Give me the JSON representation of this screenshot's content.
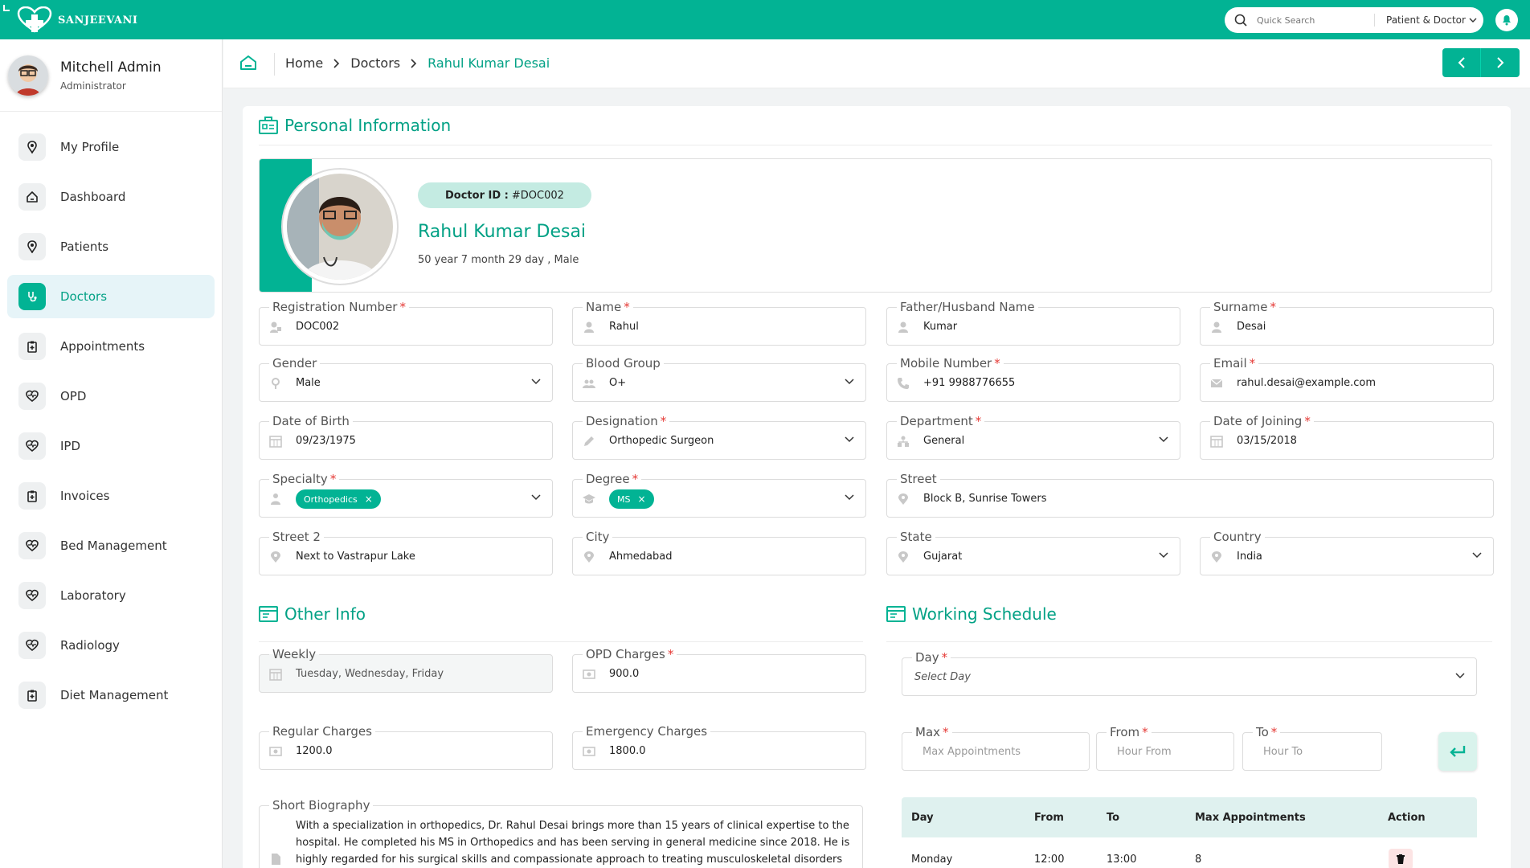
{
  "brand": {
    "name": "SANJEEVANI"
  },
  "colors": {
    "primary": "#02b394",
    "primary_text": "#02a185",
    "active_bg": "#e6f4f8",
    "required": "#e53935"
  },
  "search": {
    "placeholder": "Quick Search",
    "scope": "Patient & Doctor"
  },
  "user": {
    "name": "Mitchell Admin",
    "role": "Administrator"
  },
  "nav": [
    {
      "label": "My Profile",
      "icon": "user-icon"
    },
    {
      "label": "Dashboard",
      "icon": "home-icon"
    },
    {
      "label": "Patients",
      "icon": "user-icon"
    },
    {
      "label": "Doctors",
      "icon": "stethoscope-icon",
      "active": true
    },
    {
      "label": "Appointments",
      "icon": "clipboard-icon"
    },
    {
      "label": "OPD",
      "icon": "heartbeat-icon"
    },
    {
      "label": "IPD",
      "icon": "heartbeat-icon"
    },
    {
      "label": "Invoices",
      "icon": "clipboard-icon"
    },
    {
      "label": "Bed Management",
      "icon": "heartbeat-icon"
    },
    {
      "label": "Laboratory",
      "icon": "heartbeat-icon"
    },
    {
      "label": "Radiology",
      "icon": "heartbeat-icon"
    },
    {
      "label": "Diet Management",
      "icon": "clipboard-icon"
    }
  ],
  "breadcrumb": [
    "Home",
    "Doctors",
    "Rahul Kumar Desai"
  ],
  "personal": {
    "title": "Personal Information",
    "doctor_id_label": "Doctor ID :",
    "doctor_id": "#DOC002",
    "name": "Rahul Kumar Desai",
    "age": "50 year 7 month 29 day , Male"
  },
  "fields": {
    "registration_number": {
      "label": "Registration Number",
      "value": "DOC002"
    },
    "name": {
      "label": "Name",
      "value": "Rahul"
    },
    "father_name": {
      "label": "Father/Husband Name",
      "value": "Kumar"
    },
    "surname": {
      "label": "Surname",
      "value": "Desai"
    },
    "gender": {
      "label": "Gender",
      "value": "Male"
    },
    "blood_group": {
      "label": "Blood Group",
      "value": "O+"
    },
    "mobile": {
      "label": "Mobile Number",
      "value": "+91 9988776655"
    },
    "email": {
      "label": "Email",
      "value": "rahul.desai@example.com"
    },
    "dob": {
      "label": "Date of Birth",
      "value": "09/23/1975"
    },
    "designation": {
      "label": "Designation",
      "value": "Orthopedic Surgeon"
    },
    "department": {
      "label": "Department",
      "value": "General"
    },
    "doj": {
      "label": "Date of Joining",
      "value": "03/15/2018"
    },
    "specialty": {
      "label": "Specialty",
      "value": "Orthopedics"
    },
    "degree": {
      "label": "Degree",
      "value": "MS"
    },
    "street": {
      "label": "Street",
      "value": "Block B, Sunrise Towers"
    },
    "street2": {
      "label": "Street 2",
      "value": "Next to Vastrapur Lake"
    },
    "city": {
      "label": "City",
      "value": "Ahmedabad"
    },
    "state": {
      "label": "State",
      "value": "Gujarat"
    },
    "country": {
      "label": "Country",
      "value": "India"
    }
  },
  "other": {
    "title": "Other Info",
    "weekly": {
      "label": "Weekly",
      "value": "Tuesday, Wednesday, Friday"
    },
    "opd_charges": {
      "label": "OPD Charges",
      "value": "900.0"
    },
    "regular_charges": {
      "label": "Regular Charges",
      "value": "1200.0"
    },
    "emergency_charges": {
      "label": "Emergency Charges",
      "value": "1800.0"
    },
    "bio": {
      "label": "Short Biography",
      "value": "With a specialization in orthopedics, Dr. Rahul Desai brings more than 15 years of clinical expertise to the hospital. He completed his MS in Orthopedics and has been serving in general medicine since 2018. He is highly regarded for his surgical skills and compassionate approach to treating musculoskeletal disorders and trauma"
    }
  },
  "schedule": {
    "title": "Working Schedule",
    "day": {
      "label": "Day",
      "placeholder": "Select Day"
    },
    "max": {
      "label": "Max",
      "placeholder": "Max Appointments"
    },
    "from": {
      "label": "From",
      "placeholder": "Hour From"
    },
    "to": {
      "label": "To",
      "placeholder": "Hour To"
    },
    "table_headers": [
      "Day",
      "From",
      "To",
      "Max Appointments",
      "Action"
    ],
    "rows": [
      {
        "day": "Monday",
        "from": "12:00",
        "to": "13:00",
        "max": "8"
      }
    ]
  }
}
